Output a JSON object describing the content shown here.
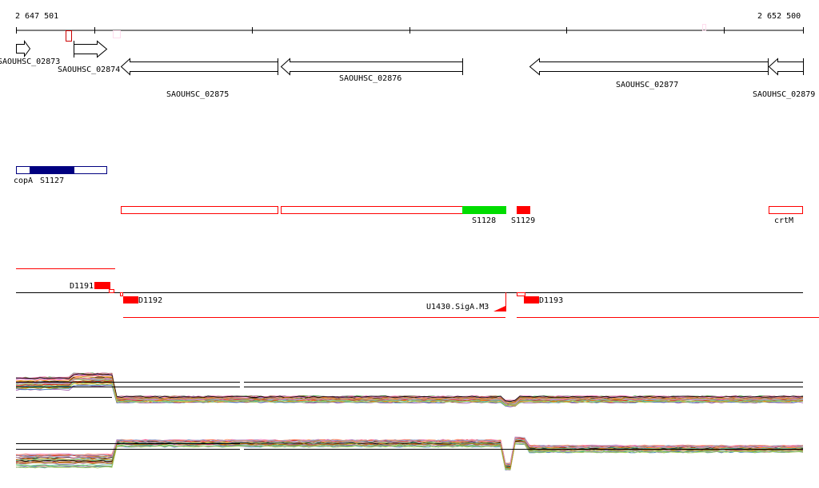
{
  "ruler": {
    "start_label": "2 647 501",
    "end_label": "2 652 500"
  },
  "genes": [
    {
      "label": "SAOUHSC_02873",
      "strand": "+"
    },
    {
      "label": "SAOUHSC_02874",
      "strand": "+"
    },
    {
      "label": "SAOUHSC_02875",
      "strand": "-"
    },
    {
      "label": "SAOUHSC_02876",
      "strand": "-"
    },
    {
      "label": "SAOUHSC_02877",
      "strand": "-"
    },
    {
      "label": "SAOUHSC_02879",
      "strand": "-"
    }
  ],
  "features_blue": [
    {
      "label": "copA"
    },
    {
      "label": "S1127"
    }
  ],
  "features_red": [
    {
      "label": "S1128"
    },
    {
      "label": "S1129"
    },
    {
      "label": "crtM"
    }
  ],
  "segments": [
    {
      "label": "D1191"
    },
    {
      "label": "D1192"
    },
    {
      "label": "D1193"
    }
  ],
  "promoter": {
    "label": "U1430.SigA.M3"
  },
  "colors": {
    "blue": "#000080",
    "green": "#00dd00",
    "red": "#ff0000"
  }
}
